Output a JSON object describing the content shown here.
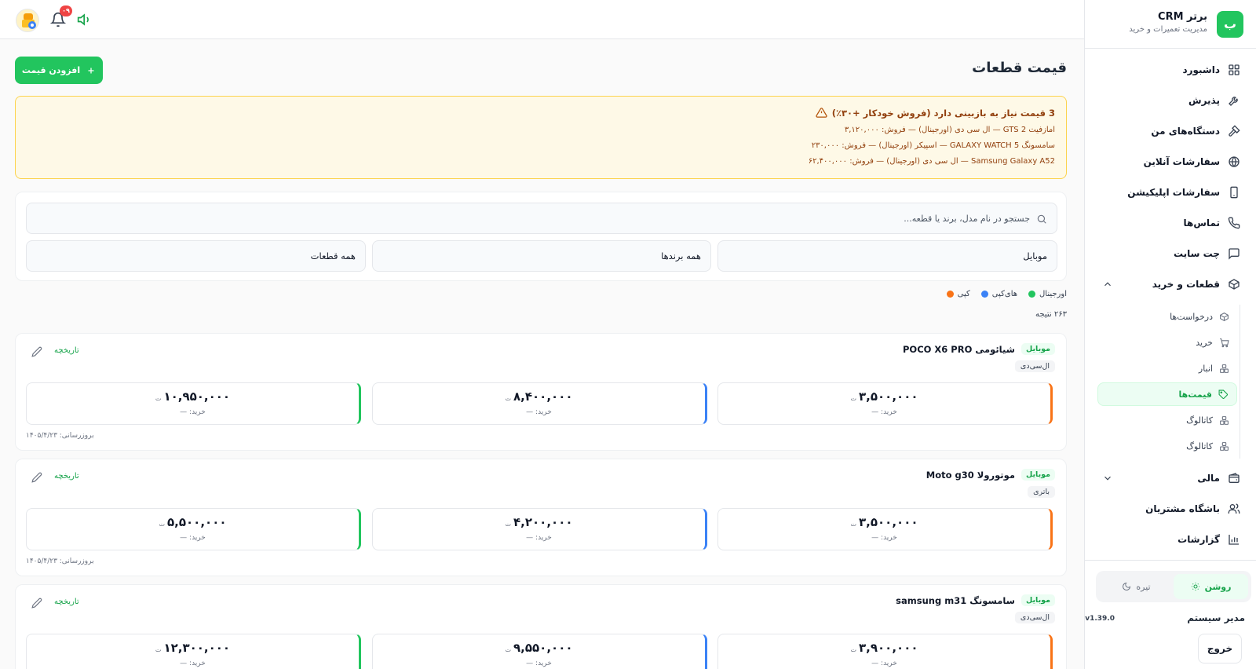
{
  "brand": {
    "logo_letter": "ب",
    "title": "برتر CRM",
    "subtitle": "مدیریت تعمیرات و خرید"
  },
  "topbar": {
    "notification_count": "۰۹"
  },
  "nav": {
    "dashboard": "داشبورد",
    "reception": "پذیرش",
    "my_devices": "دستگاه‌های من",
    "online_orders": "سفارشات آنلاین",
    "app_orders": "سفارشات اپلیکیشن",
    "calls": "تماس‌ها",
    "site_chat": "چت سایت",
    "parts_purchase": "قطعات و خرید",
    "sub": {
      "requests": "درخواست‌ها",
      "purchase": "خرید",
      "warehouse": "انبار",
      "prices": "قیمت‌ها",
      "catalog1": "کاتالوگ",
      "catalog2": "کاتالوگ"
    },
    "finance": "مالی",
    "customer_club": "باشگاه مشتریان",
    "reports": "گزارشات"
  },
  "theme": {
    "light": "روشن",
    "dark": "تیره"
  },
  "user": {
    "name": "مدیر سیستم",
    "version": "v1.39.0",
    "logout": "خروج"
  },
  "page": {
    "title": "قیمت قطعات",
    "add_button": "افزودن قیمت"
  },
  "alert": {
    "title": "3 قیمت نیاز به بازبینی دارد (فروش خودکار +۳۰٪)",
    "lines": [
      "امازفیت GTS 2 — ال سی دی (اورجینال) — فروش: ۳,۱۲۰,۰۰۰",
      "سامسونگ GALAXY WATCH 5 — اسپیکر (اورجینال) — فروش: ۲۳۰,۰۰۰",
      "Samsung Galaxy A52 — ال سی دی (اورجینال) — فروش: ۶۲,۴۰۰,۰۰۰"
    ]
  },
  "filters": {
    "search_placeholder": "جستجو در نام مدل، برند یا قطعه...",
    "category": "موبایل",
    "brand": "همه برندها",
    "part": "همه قطعات"
  },
  "legend": [
    {
      "label": "کپی",
      "color": "#f97316"
    },
    {
      "label": "های‌کپی",
      "color": "#3b82f6"
    },
    {
      "label": "اورجینال",
      "color": "#22c55e"
    }
  ],
  "result_count": "۲۶۳ نتیجه",
  "labels": {
    "history": "تاریخچه",
    "buy_prefix": "خرید: —",
    "currency": "ت",
    "updated_prefix": "بروزرسانی:"
  },
  "cards": [
    {
      "category": "موبایل",
      "model": "شیائومی POCO X6 PRO",
      "part": "ال‌سی‌دی",
      "prices": {
        "copy": "۳,۵۰۰,۰۰۰",
        "hicopy": "۸,۴۰۰,۰۰۰",
        "original": "۱۰,۹۵۰,۰۰۰"
      },
      "updated": "بروزرسانی: ۱۴۰۵/۴/۲۳"
    },
    {
      "category": "موبایل",
      "model": "موتورولا Moto g30",
      "part": "باتری",
      "prices": {
        "copy": "۳,۵۰۰,۰۰۰",
        "hicopy": "۴,۲۰۰,۰۰۰",
        "original": "۵,۵۰۰,۰۰۰"
      },
      "updated": "بروزرسانی: ۱۴۰۵/۴/۲۳"
    },
    {
      "category": "موبایل",
      "model": "سامسونگ samsung m31",
      "part": "ال‌سی‌دی",
      "prices": {
        "copy": "۳,۹۰۰,۰۰۰",
        "hicopy": "۹,۵۵۰,۰۰۰",
        "original": "۱۲,۳۰۰,۰۰۰"
      },
      "updated": ""
    }
  ]
}
